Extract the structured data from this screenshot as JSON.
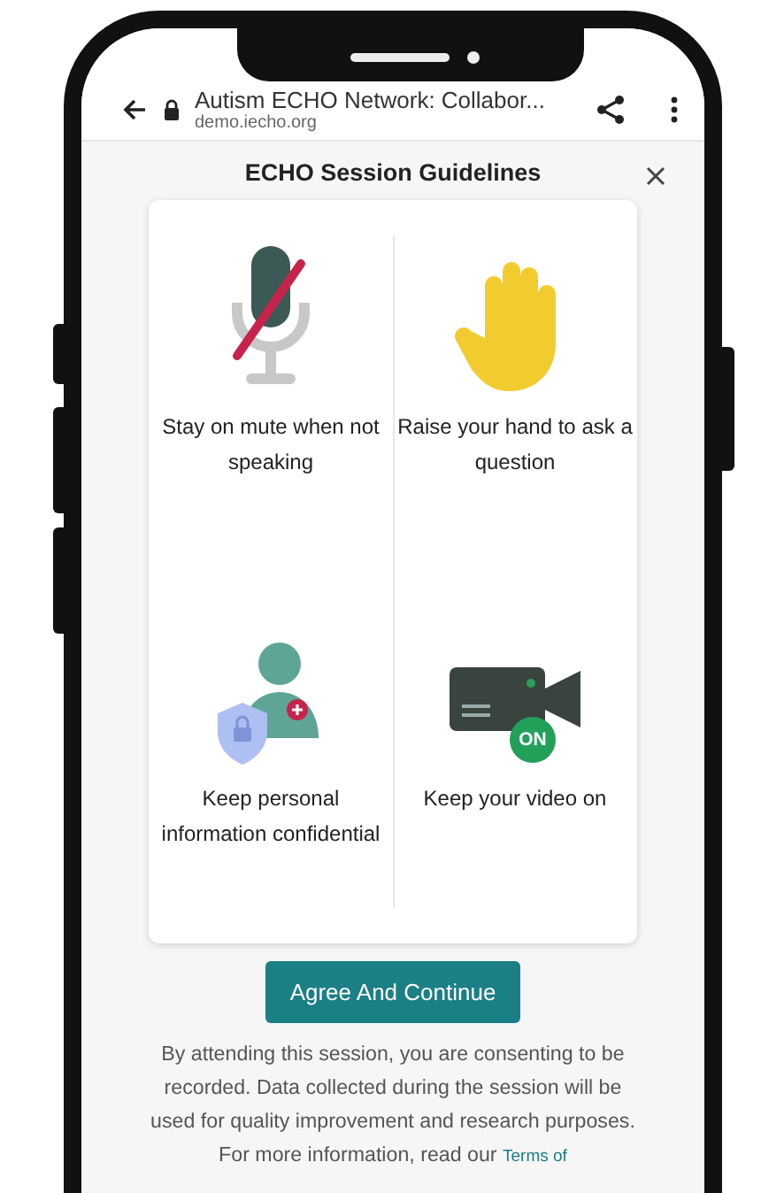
{
  "browser": {
    "title": "Autism ECHO Network: Collabor...",
    "url": "demo.iecho.org"
  },
  "dialog": {
    "title": "ECHO Session Guidelines",
    "guidelines": [
      {
        "kind": "muted-mic",
        "text": "Stay on mute when not speaking"
      },
      {
        "kind": "raised-hand",
        "text": "Raise your hand to ask a question"
      },
      {
        "kind": "privacy",
        "text": "Keep personal information confidential"
      },
      {
        "kind": "video-on",
        "text": "Keep your video on"
      }
    ],
    "video_badge": "ON",
    "button": "Agree And Continue",
    "consent": {
      "text": "By attending this session, you are consenting to be recorded. Data collected during the session will be used for quality improvement and research purposes. For more information, read our",
      "link": "Terms of"
    }
  }
}
